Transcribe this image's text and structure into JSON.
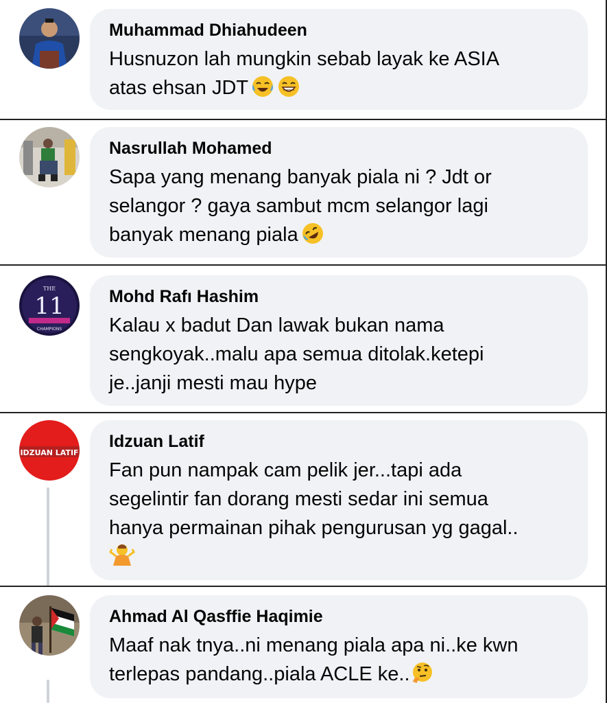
{
  "comments": [
    {
      "name": "Muhammad Dhiahudeen",
      "text": "Husnuzon lah mungkin sebab layak ke ASIA\natas ehsan JDT",
      "emoji": [
        "face-with-tears-of-joy",
        "grinning-face-with-smiling-eyes"
      ]
    },
    {
      "name": "Nasrullah Mohamed",
      "text": "Sapa yang menang banyak piala ni ? Jdt or\nselangor ? gaya sambut mcm selangor lagi\nbanyak menang piala",
      "emoji": [
        "rolling-on-the-floor-laughing"
      ]
    },
    {
      "name": "Mohd Rafı Hashim",
      "text": "Kalau x badut Dan lawak bukan nama\nsengkoyak..malu apa semua ditolak.ketepi\nje..janji mesti mau hype",
      "emoji": []
    },
    {
      "name": "Idzuan Latif",
      "text": "Fan pun nampak cam pelik jer...tapi ada\nsegelintir fan dorang mesti sedar ini semua\nhanya permainan pihak pengurusan yg gagal..",
      "emoji": [
        "person-shrugging"
      ]
    },
    {
      "name": "Ahmad Al Qasffie Haqimie",
      "text": "Maaf nak tnya..ni menang piala apa ni..ke kwn\nterlepas pandang..piala ACLE ke..",
      "emoji": [
        "thinking-face"
      ]
    }
  ],
  "avatars": {
    "avatar_3_text_top": "THE",
    "avatar_3_text_mid": "11",
    "avatar_3_text_bot": "CHAMPIONS",
    "avatar_4_text": "IDZUAN LATIF"
  },
  "colors": {
    "bubble": "#f0f2f5",
    "text": "#050505",
    "thread": "#cfd3d8"
  }
}
